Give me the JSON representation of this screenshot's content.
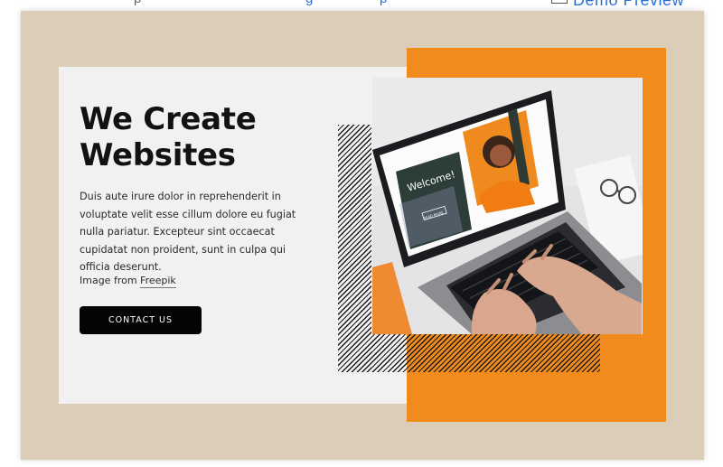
{
  "top_bar": {
    "fragment_left": "p",
    "fragment_mid": "g",
    "fragment_right": "p",
    "demo_label": "Demo Preview"
  },
  "hero": {
    "title": "We Create Websites",
    "body": "Duis aute irure dolor in reprehenderit in voluptate velit esse cillum dolore eu fugiat nulla pariatur. Excepteur sint occaecat cupidatat non proident, sunt in culpa qui officia deserunt.",
    "credit_prefix": "Image from ",
    "credit_link": "Freepik",
    "cta_label": "CONTACT US"
  },
  "laptop_screen": {
    "welcome_text": "Welcome!",
    "button_text": "READ MORE"
  },
  "colors": {
    "background": "#dccdb9",
    "panel": "#f1f1f1",
    "accent": "#f18b1d",
    "button": "#050505"
  }
}
